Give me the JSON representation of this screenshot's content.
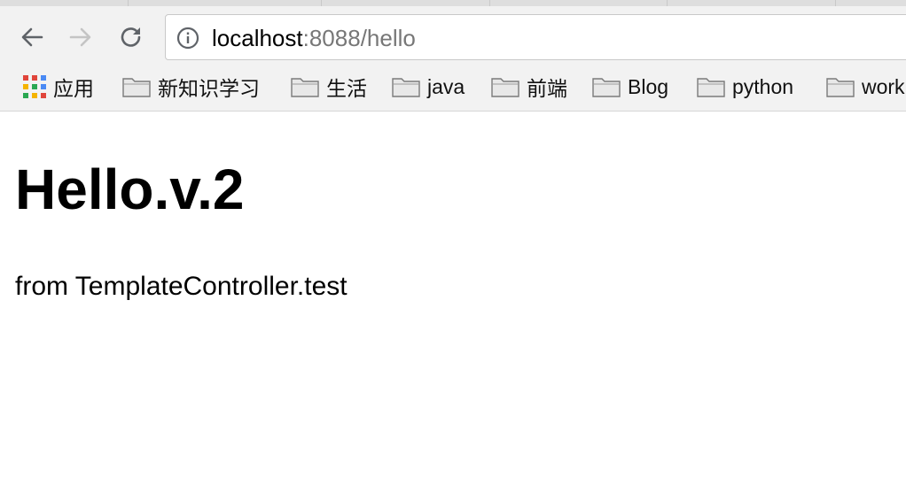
{
  "browser": {
    "address_bar": {
      "host": "localhost",
      "rest": ":8088/hello"
    },
    "bookmarks": [
      {
        "label": "应用",
        "icon": "apps-grid-icon"
      },
      {
        "label": "新知识学习",
        "icon": "folder-icon"
      },
      {
        "label": "生活",
        "icon": "folder-icon"
      },
      {
        "label": "java",
        "icon": "folder-icon"
      },
      {
        "label": "前端",
        "icon": "folder-icon"
      },
      {
        "label": "Blog",
        "icon": "folder-icon"
      },
      {
        "label": "python",
        "icon": "folder-icon"
      },
      {
        "label": "work",
        "icon": "folder-icon"
      }
    ]
  },
  "page": {
    "heading": "Hello.v.2",
    "subtext": "from TemplateController.test"
  }
}
